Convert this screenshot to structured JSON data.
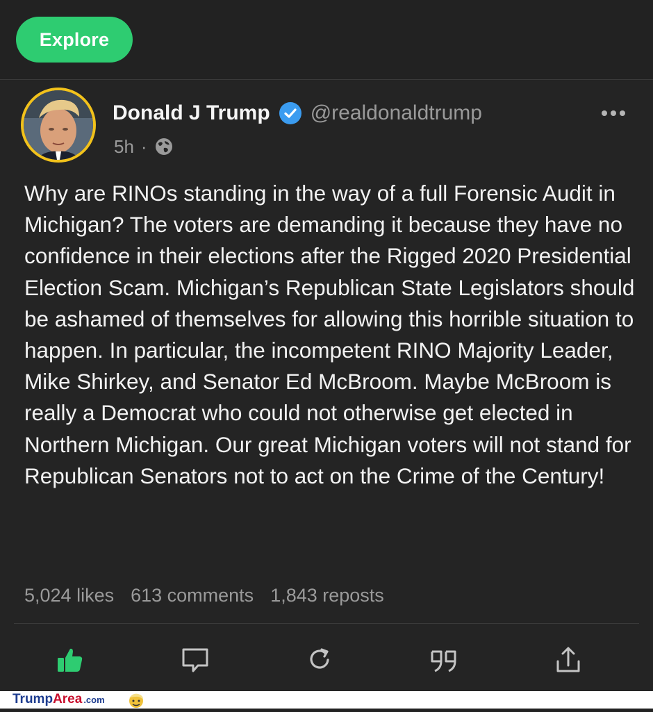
{
  "header": {
    "explore_label": "Explore"
  },
  "post": {
    "author_name": "Donald J Trump",
    "handle": "@realdonaldtrump",
    "time": "5h",
    "separator": "·",
    "verified": true,
    "visibility_icon": "globe-icon",
    "body": "Why are RINOs standing in the way of a full Forensic Audit in Michigan? The voters are demanding it because they have no confidence in their elections after the Rigged 2020 Presidential Election Scam. Michigan’s Republican State Legislators should be ashamed of themselves for allowing this horrible situation to happen. In particular, the incompetent RINO Majority Leader, Mike Shirkey, and Senator Ed McBroom. Maybe McBroom is really a Democrat who could not otherwise get elected in Northern Michigan. Our great Michigan voters will not stand for Republican Senators not to act on the Crime of the Century!",
    "stats": {
      "likes": "5,024 likes",
      "comments": "613 comments",
      "reposts": "1,843 reposts"
    }
  },
  "actions": [
    "like-icon",
    "comment-icon",
    "repost-icon",
    "quote-icon",
    "share-icon"
  ],
  "watermark": {
    "part1": "Trump",
    "part2": "Area",
    "part3": ".com"
  },
  "colors": {
    "background": "#222222",
    "accent_green": "#2ecc71",
    "avatar_ring": "#f2c21b",
    "verified_blue": "#3b9cf0",
    "muted_text": "#9a9a9a"
  }
}
